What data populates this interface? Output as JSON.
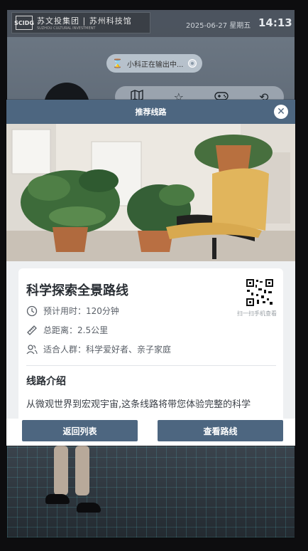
{
  "header": {
    "logo_mark": "SCIDG",
    "logo_text": "苏文投集团 | 苏州科技馆",
    "logo_sub": "SUZHOU CULTURAL INVESTMENT",
    "date": "2025-06-27  星期五",
    "time": "14:13"
  },
  "status": {
    "label": "小科正在输出中..."
  },
  "toolbar": {
    "icons": [
      "map-icon",
      "star-icon",
      "gamepad-icon",
      "refresh-icon"
    ]
  },
  "modal": {
    "title": "推荐线路",
    "route_title": "科学探索全景路线",
    "qr_caption": "扫一扫手机查看",
    "duration": "预计用时：120分钟",
    "distance": "总距离：2.5公里",
    "audience": "适合人群：科学爱好者、亲子家庭",
    "intro_heading": "线路介绍",
    "intro_text": "从微观世界到宏观宇宙,这条线路将带您体验完整的科学",
    "back_button": "返回列表",
    "view_button": "查看路线"
  },
  "colors": {
    "header_blue": "#4d6680",
    "button_blue": "#4d6680"
  }
}
